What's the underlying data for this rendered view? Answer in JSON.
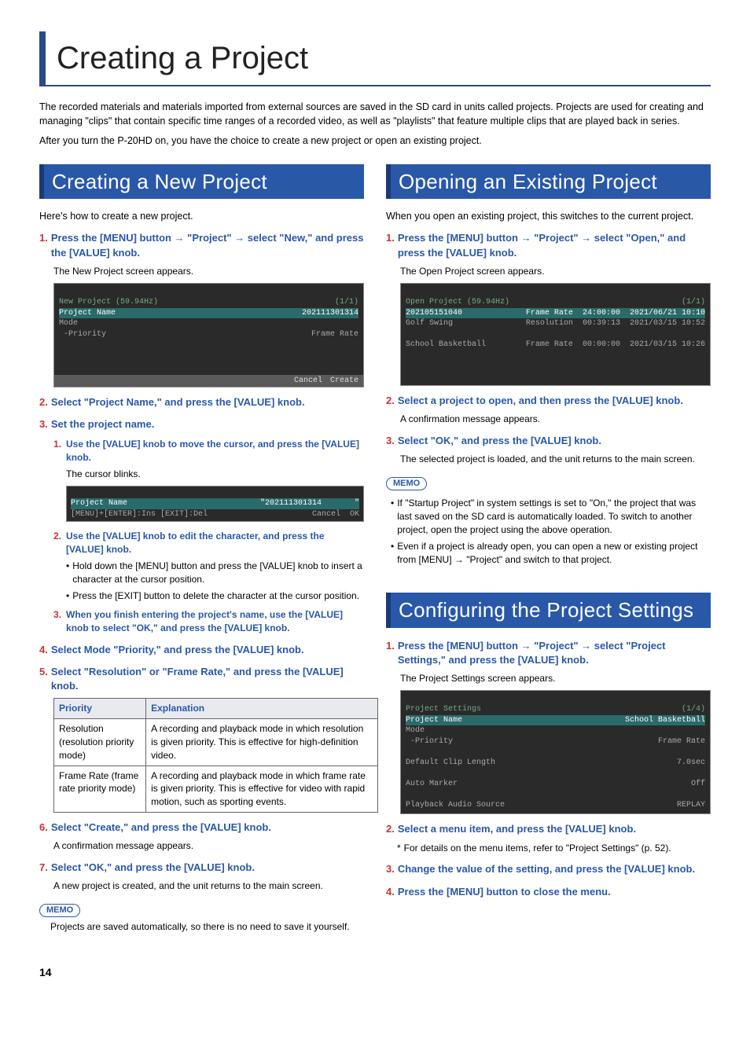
{
  "page_title": "Creating a Project",
  "intro1": "The recorded materials and materials imported from external sources are saved in the SD card in units called projects. Projects are used for creating and managing \"clips\" that contain specific time ranges of a recorded video, as well as \"playlists\" that feature multiple clips that are played back in series.",
  "intro2": "After you turn the P-20HD on, you have the choice to create a new project or open an existing project.",
  "left": {
    "heading": "Creating a New Project",
    "lead": "Here's how to create a new project.",
    "step1_num": "1.",
    "step1": "Press the [MENU] button → \"Project\" → select \"New,\" and press the [VALUE] knob.",
    "step1_sub": "The New Project screen appears.",
    "ss1": {
      "title": "New Project (59.94Hz)",
      "page": "(1/1)",
      "row1a": "Project Name",
      "row1b": "202111301314",
      "row2a": "Mode",
      "row3a": " -Priority",
      "row3b": "Frame Rate",
      "cancel": "Cancel",
      "create": "Create"
    },
    "step2_num": "2.",
    "step2": "Select \"Project Name,\" and press the [VALUE] knob.",
    "step3_num": "3.",
    "step3": "Set the project name.",
    "s3_1_num": "1.",
    "s3_1": "Use the [VALUE] knob to move the cursor, and press the [VALUE] knob.",
    "s3_1_sub": "The cursor blinks.",
    "ss2": {
      "row1a": "Project Name",
      "row1b": "\"202111301314       \"",
      "hint": "[MENU]+[ENTER]:Ins [EXIT]:Del",
      "cancel": "Cancel",
      "ok": "OK"
    },
    "s3_2_num": "2.",
    "s3_2": "Use the [VALUE] knob to edit the character, and press the [VALUE] knob.",
    "s3_2_b1": "Hold down the [MENU] button and press the [VALUE] knob to insert a character at the cursor position.",
    "s3_2_b2": "Press the [EXIT] button to delete the character at the cursor position.",
    "s3_3_num": "3.",
    "s3_3": "When you finish entering the project's name, use the [VALUE] knob to select \"OK,\" and press the [VALUE] knob.",
    "step4_num": "4.",
    "step4": "Select Mode \"Priority,\" and press the [VALUE] knob.",
    "step5_num": "5.",
    "step5": "Select \"Resolution\" or \"Frame Rate,\" and press the [VALUE] knob.",
    "table": {
      "h1": "Priority",
      "h2": "Explanation",
      "r1a": "Resolution (resolution priority mode)",
      "r1b": "A recording and playback mode in which resolution is given priority. This is effective for high-definition video.",
      "r2a": "Frame Rate (frame rate priority mode)",
      "r2b": "A recording and playback mode in which frame rate is given priority. This is effective for video with rapid motion, such as sporting events."
    },
    "step6_num": "6.",
    "step6": "Select \"Create,\" and press the [VALUE] knob.",
    "step6_sub": "A confirmation message appears.",
    "step7_num": "7.",
    "step7": "Select \"OK,\" and press the [VALUE] knob.",
    "step7_sub": "A new project is created, and the unit returns to the main screen.",
    "memo_label": "MEMO",
    "memo": "Projects are saved automatically, so there is no need to save it yourself."
  },
  "right_open": {
    "heading": "Opening an Existing Project",
    "lead": "When you open an existing project, this switches to the current project.",
    "step1_num": "1.",
    "step1": "Press the [MENU] button → \"Project\" → select \"Open,\" and press the [VALUE] knob.",
    "step1_sub": "The Open Project screen appears.",
    "ss": {
      "title": "Open Project (59.94Hz)",
      "page": "(1/1)",
      "r1a": "202105151040",
      "r1b": "Frame Rate",
      "r1c": "24:00:00",
      "r1d": "2021/06/21 10:10",
      "r2a": "Golf Swing",
      "r2b": "Resolution",
      "r2c": "00:39:13",
      "r2d": "2021/03/15 10:52",
      "r3a": "School Basketball",
      "r3b": "Frame Rate",
      "r3c": "00:00:00",
      "r3d": "2021/03/15 10:26"
    },
    "step2_num": "2.",
    "step2": "Select a project to open, and then press the [VALUE] knob.",
    "step2_sub": "A confirmation message appears.",
    "step3_num": "3.",
    "step3": "Select \"OK,\" and press the [VALUE] knob.",
    "step3_sub": "The selected project is loaded, and the unit returns to the main screen.",
    "memo_label": "MEMO",
    "memo1": "If \"Startup Project\" in system settings is set to \"On,\" the project that was last saved on the SD card is automatically loaded. To switch to another project, open the project using the above operation.",
    "memo2": "Even if a project is already open, you can open a new or existing project from [MENU] → \"Project\" and switch to that project."
  },
  "right_conf": {
    "heading": "Configuring the Project Settings",
    "step1_num": "1.",
    "step1": "Press the [MENU] button → \"Project\" → select \"Project Settings,\" and press the [VALUE] knob.",
    "step1_sub": "The Project Settings screen appears.",
    "ss": {
      "title": "Project Settings",
      "page": "(1/4)",
      "r1a": "Project Name",
      "r1b": "School Basketball",
      "r2a": "Mode",
      "r3a": " -Priority",
      "r3b": "Frame Rate",
      "r4a": "Default Clip Length",
      "r4b": "7.0sec",
      "r5a": "Auto Marker",
      "r5b": "Off",
      "r6a": "Playback Audio Source",
      "r6b": "REPLAY"
    },
    "step2_num": "2.",
    "step2": "Select a menu item, and press the [VALUE] knob.",
    "step2_note": "For details on the menu items, refer to \"Project Settings\" (p. 52).",
    "step3_num": "3.",
    "step3": "Change the value of the setting, and press the [VALUE] knob.",
    "step4_num": "4.",
    "step4": "Press the [MENU] button to close the menu."
  },
  "page_num": "14"
}
